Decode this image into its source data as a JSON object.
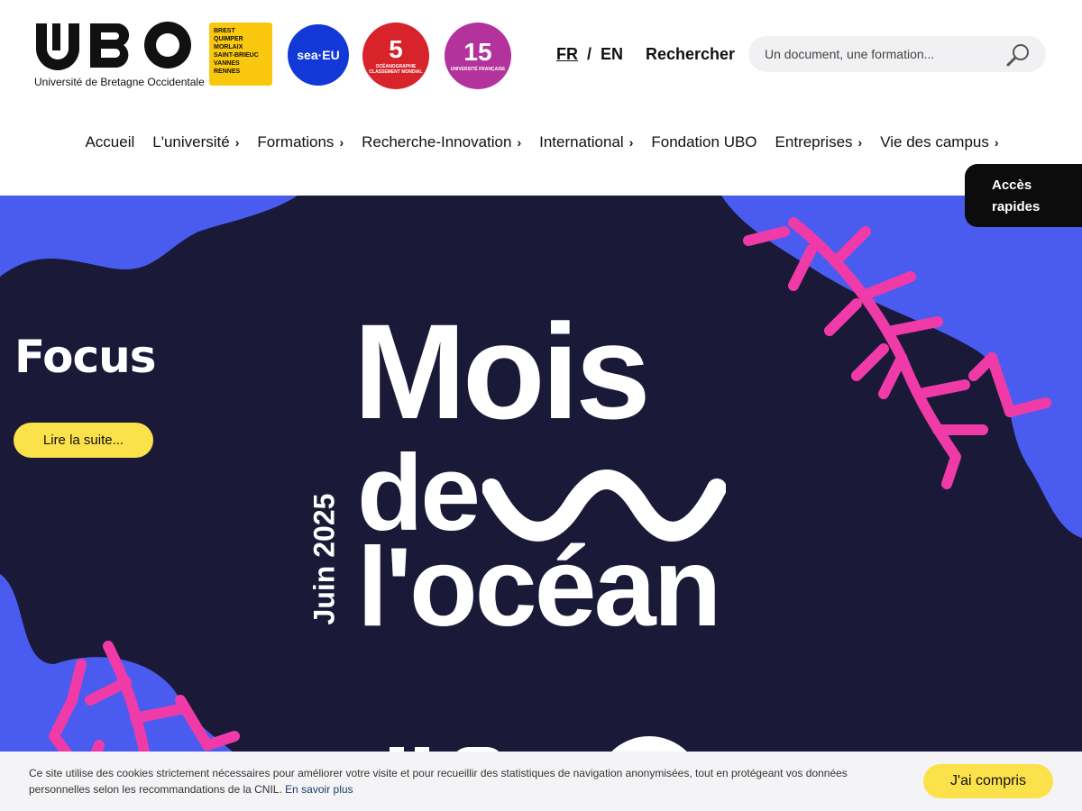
{
  "header": {
    "logo_text": "UBO",
    "logo_subtitle": "Université de Bretagne Occidentale",
    "cities": [
      "BREST",
      "QUIMPER",
      "MORLAIX",
      "SAINT-BRIEUC",
      "VANNES",
      "RENNES"
    ],
    "badge_sea": "sea·EU",
    "badge_oceano": {
      "number": "5",
      "text": "Océanographie classement mondial"
    },
    "badge_univ": {
      "number": "15",
      "text": "Université française"
    },
    "lang_fr": "FR",
    "lang_sep": "/",
    "lang_en": "EN",
    "search_label": "Rechercher",
    "search_placeholder": "Un document, une formation..."
  },
  "nav": {
    "items": [
      {
        "label": "Accueil",
        "has_submenu": false
      },
      {
        "label": "L'université",
        "has_submenu": true
      },
      {
        "label": "Formations",
        "has_submenu": true
      },
      {
        "label": "Recherche-Innovation",
        "has_submenu": true
      },
      {
        "label": "International",
        "has_submenu": true
      },
      {
        "label": "Fondation UBO",
        "has_submenu": false
      },
      {
        "label": "Entreprises",
        "has_submenu": true
      },
      {
        "label": "Vie des campus",
        "has_submenu": true
      }
    ],
    "chevron": "›"
  },
  "quick_access": {
    "line1": "Accès",
    "line2": "rapides"
  },
  "hero": {
    "title": "Focus",
    "button": "Lire la suite...",
    "poster_line1": "Mois",
    "poster_line2": "de",
    "poster_line3": "l'océan",
    "poster_date": "Juin 2025"
  },
  "cookie": {
    "text": "Ce site utilise des cookies strictement nécessaires pour améliorer votre visite et pour recueillir des statistiques de navigation anonymisées, tout en protégeant vos données personnelles selon les recommandations de la CNIL.",
    "link": "En savoir plus",
    "button": "J'ai compris"
  },
  "colors": {
    "accent_yellow": "#fbe14a",
    "hero_bg": "#1a1a38",
    "coral_pink": "#f03aa8",
    "wave_blue": "#4a5cf0"
  }
}
